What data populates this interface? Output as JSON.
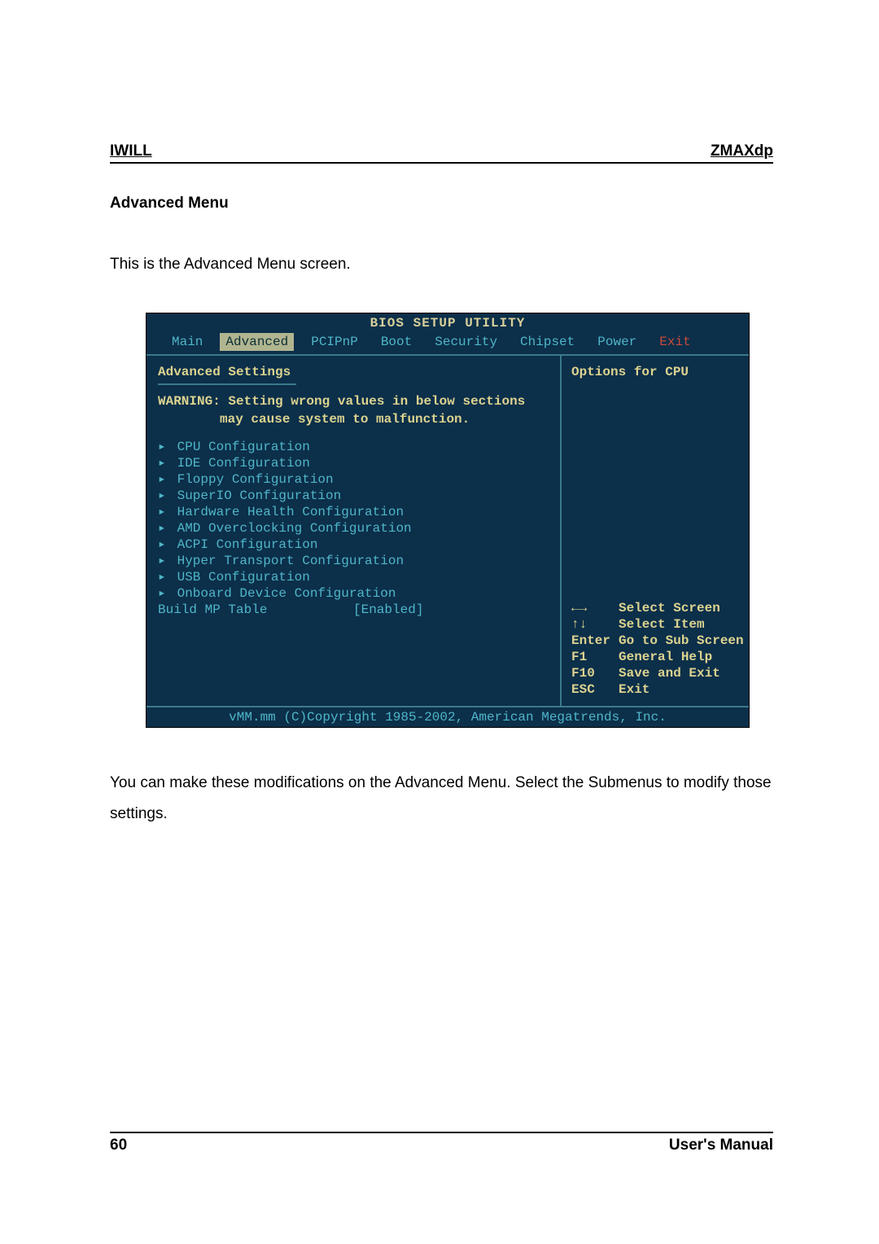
{
  "header": {
    "left": "IWILL",
    "right": "ZMAXdp"
  },
  "section_title": "Advanced Menu",
  "intro_text": "This is the Advanced Menu screen.",
  "outro_text": "You can make these modifications on the Advanced Menu. Select the Submenus to modify those settings.",
  "footer": {
    "page": "60",
    "label": "User's  Manual"
  },
  "bios": {
    "title": "BIOS SETUP UTILITY",
    "tabs": [
      "Main",
      "Advanced",
      "PCIPnP",
      "Boot",
      "Security",
      "Chipset",
      "Power",
      "Exit"
    ],
    "active_tab_index": 1,
    "left_heading": "Advanced Settings",
    "warning_line1": "WARNING: Setting wrong values in below sections",
    "warning_line2": "may cause system to malfunction.",
    "submenus": [
      "CPU Configuration",
      "IDE Configuration",
      "Floppy Configuration",
      "SuperIO Configuration",
      "Hardware Health Configuration",
      "AMD Overclocking Configuration",
      "ACPI Configuration",
      "Hyper Transport Configuration",
      "USB Configuration",
      "Onboard Device Configuration"
    ],
    "selected_submenu_index": 0,
    "setting": {
      "label": "Build MP Table",
      "value": "[Enabled]"
    },
    "right_heading": "Options for CPU",
    "keys": [
      {
        "key": "←→",
        "desc": "Select Screen"
      },
      {
        "key": "↑↓",
        "desc": "Select Item"
      },
      {
        "key": "Enter",
        "desc": "Go to Sub Screen"
      },
      {
        "key": "F1",
        "desc": "General Help"
      },
      {
        "key": "F10",
        "desc": "Save and Exit"
      },
      {
        "key": "ESC",
        "desc": "Exit"
      }
    ],
    "copyright": "vMM.mm (C)Copyright 1985-2002, American Megatrends, Inc."
  }
}
